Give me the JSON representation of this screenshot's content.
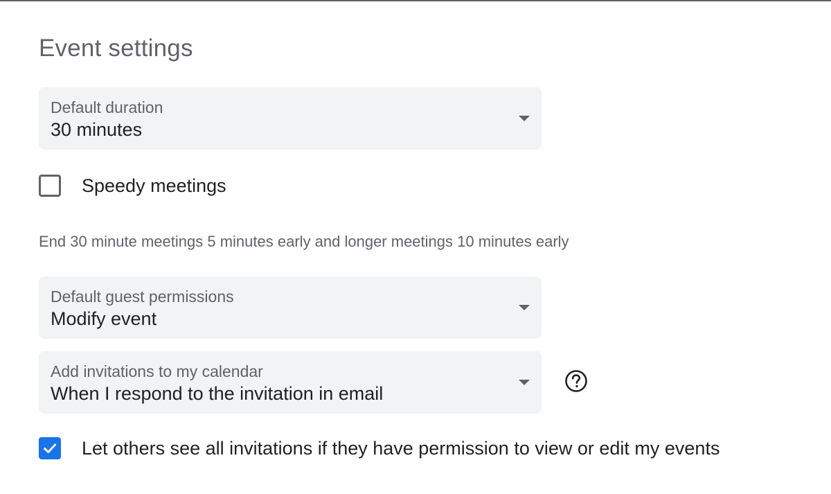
{
  "section": {
    "title": "Event settings"
  },
  "default_duration": {
    "label": "Default duration",
    "value": "30 minutes"
  },
  "speedy_meetings": {
    "label": "Speedy meetings",
    "checked": false,
    "helper": "End 30 minute meetings 5 minutes early and longer meetings 10 minutes early"
  },
  "guest_permissions": {
    "label": "Default guest permissions",
    "value": "Modify event"
  },
  "add_invitations": {
    "label": "Add invitations to my calendar",
    "value": "When I respond to the invitation in email",
    "help_icon": "help-circle-icon"
  },
  "visibility": {
    "label": "Let others see all invitations if they have permission to view or edit my events",
    "checked": true
  },
  "colors": {
    "accent": "#1a73e8",
    "field_bg": "#f1f3f4",
    "secondary_text": "#5f6368",
    "primary_text": "#202124"
  }
}
